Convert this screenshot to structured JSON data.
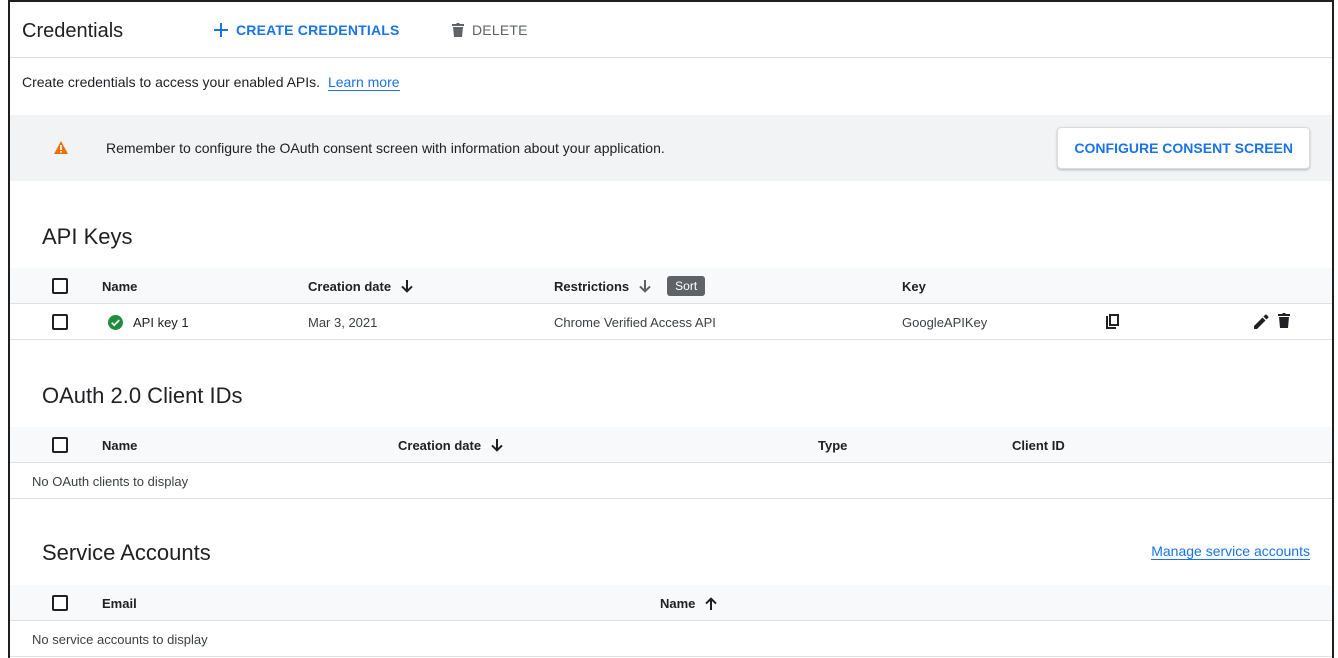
{
  "header": {
    "title": "Credentials",
    "create_label": "CREATE CREDENTIALS",
    "delete_label": "DELETE"
  },
  "intro": {
    "text": "Create credentials to access your enabled APIs.",
    "link": "Learn more"
  },
  "banner": {
    "message": "Remember to configure the OAuth consent screen with information about your application.",
    "button": "CONFIGURE CONSENT SCREEN",
    "warning_color": "#e8710a"
  },
  "api_keys": {
    "title": "API Keys",
    "columns": [
      "Name",
      "Creation date",
      "Restrictions",
      "Key"
    ],
    "sort_tooltip": "Sort",
    "rows": [
      {
        "name": "API key 1",
        "creation_date": "Mar 3, 2021",
        "restrictions": "Chrome Verified Access API",
        "key": "GoogleAPIKey",
        "status": "check-circle-icon"
      }
    ]
  },
  "oauth": {
    "title": "OAuth 2.0 Client IDs",
    "columns": [
      "Name",
      "Creation date",
      "Type",
      "Client ID"
    ],
    "empty": "No OAuth clients to display"
  },
  "service_accounts": {
    "title": "Service Accounts",
    "manage_link": "Manage service accounts",
    "columns": [
      "Email",
      "Name"
    ],
    "empty": "No service accounts to display"
  },
  "colors": {
    "accent": "#1a73e8",
    "success": "#1e8e3e",
    "banner_bg": "#f1f3f4"
  }
}
